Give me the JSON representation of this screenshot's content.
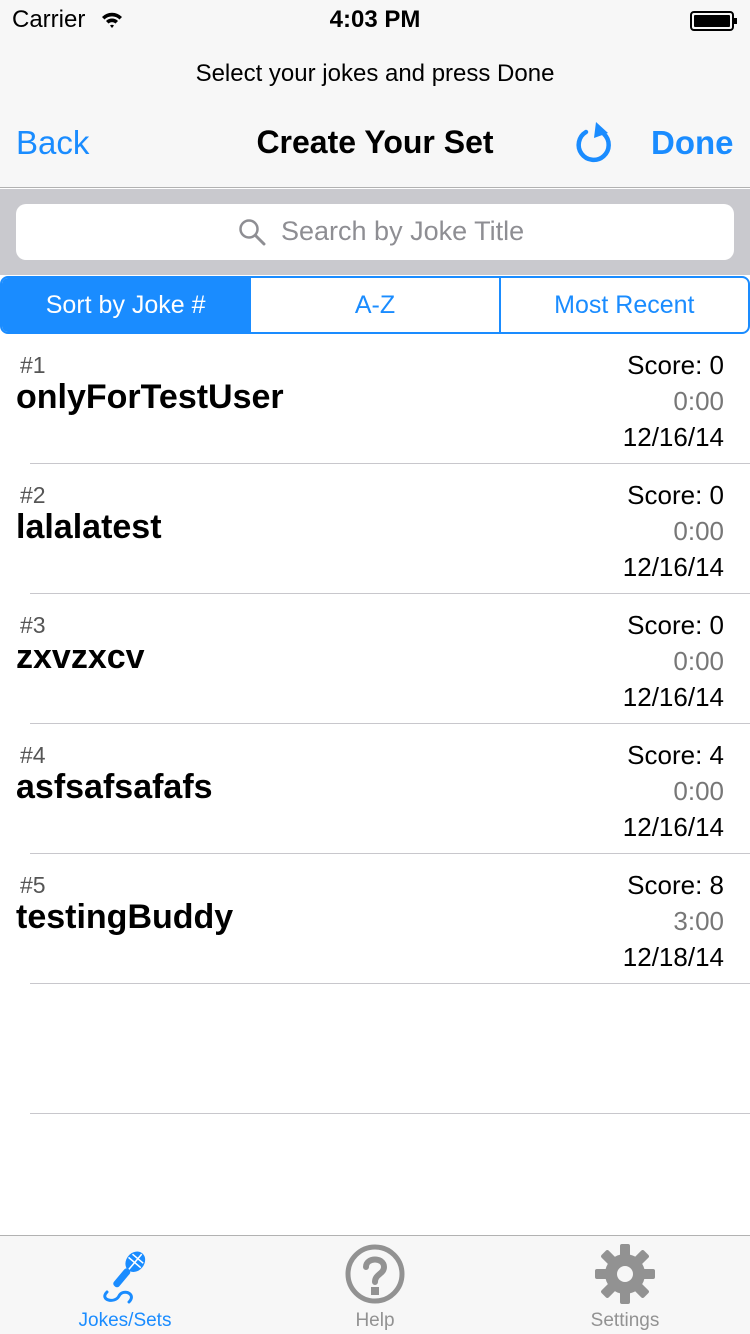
{
  "status_bar": {
    "carrier": "Carrier",
    "time": "4:03 PM"
  },
  "header": {
    "prompt": "Select your jokes and press Done",
    "back_label": "Back",
    "title": "Create Your Set",
    "done_label": "Done"
  },
  "search": {
    "placeholder": "Search by Joke Title"
  },
  "sort_tabs": [
    {
      "label": "Sort by Joke #",
      "active": true
    },
    {
      "label": "A-Z",
      "active": false
    },
    {
      "label": "Most Recent",
      "active": false
    }
  ],
  "jokes": [
    {
      "number": "#1",
      "title": "onlyForTestUser",
      "score": "Score: 0",
      "duration": "0:00",
      "date": "12/16/14"
    },
    {
      "number": "#2",
      "title": "lalalatest",
      "score": "Score: 0",
      "duration": "0:00",
      "date": "12/16/14"
    },
    {
      "number": "#3",
      "title": "zxvzxcv",
      "score": "Score: 0",
      "duration": "0:00",
      "date": "12/16/14"
    },
    {
      "number": "#4",
      "title": "asfsafsafafs",
      "score": "Score: 4",
      "duration": "0:00",
      "date": "12/16/14"
    },
    {
      "number": "#5",
      "title": "testingBuddy",
      "score": "Score: 8",
      "duration": "3:00",
      "date": "12/18/14"
    }
  ],
  "tab_bar": [
    {
      "label": "Jokes/Sets",
      "icon": "microphone-icon",
      "active": true
    },
    {
      "label": "Help",
      "icon": "question-icon",
      "active": false
    },
    {
      "label": "Settings",
      "icon": "gear-icon",
      "active": false
    }
  ],
  "colors": {
    "accent": "#1a8cff",
    "separator": "#c8c7cc",
    "inactive_tab": "#929292"
  }
}
